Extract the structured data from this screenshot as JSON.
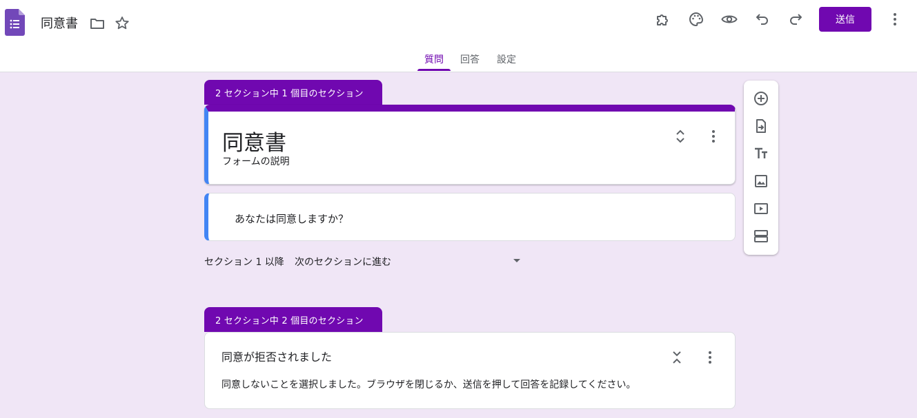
{
  "app": {
    "title": "同意書",
    "logo_icon": "google-forms-logo",
    "accent_color": "#7008b0"
  },
  "header": {
    "send_label": "送信",
    "icons": [
      "folder-icon",
      "star-icon",
      "addon-icon",
      "palette-icon",
      "preview-icon",
      "undo-icon",
      "redo-icon",
      "more-vert-icon"
    ]
  },
  "tabs": [
    {
      "label": "質問",
      "active": true
    },
    {
      "label": "回答",
      "active": false
    },
    {
      "label": "設定",
      "active": false
    }
  ],
  "sections": [
    {
      "tab_label": "2 セクション中 1 個目のセクション",
      "form_title": "同意書",
      "form_description": "フォームの説明",
      "question": "あなたは同意しますか？",
      "after_section_label": "セクション 1 以降",
      "after_section_value": "次のセクションに進む"
    },
    {
      "tab_label": "2 セクション中 2 個目のセクション",
      "title": "同意が拒否されました",
      "description": "同意しないことを選択しました。ブラウザを閉じるか、送信を押して回答を記録してください。"
    }
  ],
  "side_toolbar": {
    "icons": [
      "add-question-icon",
      "import-questions-icon",
      "add-title-icon",
      "add-image-icon",
      "add-video-icon",
      "add-section-icon"
    ]
  }
}
